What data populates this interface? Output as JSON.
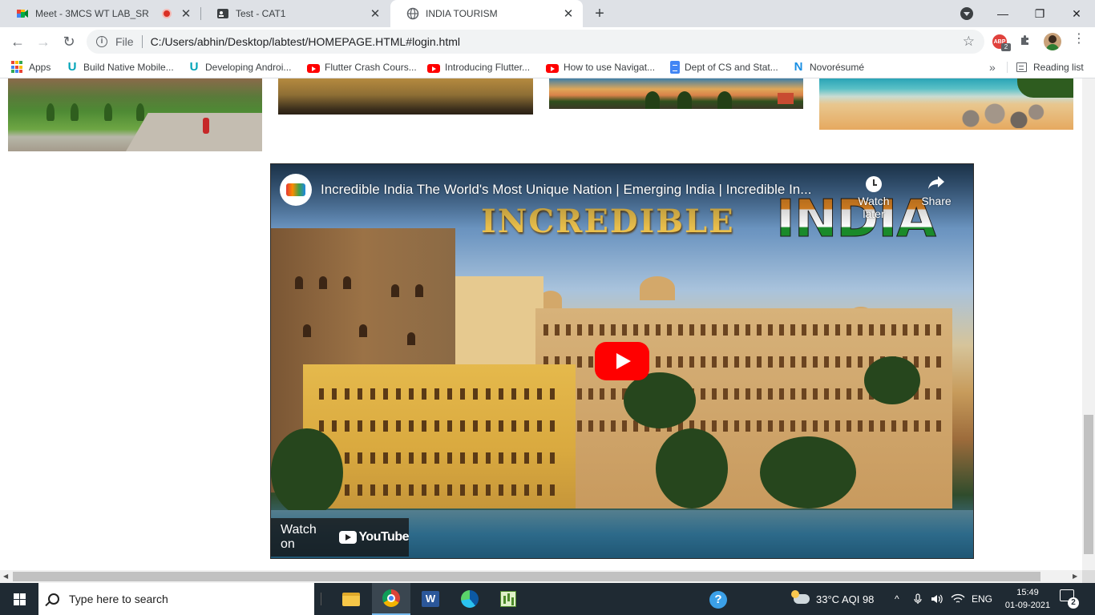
{
  "browser": {
    "tabs": [
      {
        "label": "Meet - 3MCS WT LAB_SR",
        "recording": true
      },
      {
        "label": "Test - CAT1"
      },
      {
        "label": "INDIA TOURISM",
        "active": true
      }
    ],
    "new_tab_symbol": "+",
    "window_controls": {
      "minimize": "—",
      "restore": "❐",
      "close": "✕"
    },
    "address": {
      "scheme_label": "File",
      "url": "C:/Users/abhin/Desktop/labtest/HOMEPAGE.HTML#login.html"
    },
    "extensions": {
      "abp_label": "ABP",
      "abp_badge": "2"
    },
    "nav": {
      "back": "←",
      "forward": "→",
      "reload": "↻",
      "star": "☆",
      "menu": "⋮"
    }
  },
  "bookmarks": {
    "items": [
      {
        "label": "Apps",
        "icon": "apps-grid-icon"
      },
      {
        "label": "Build Native Mobile...",
        "icon": "udemy-icon"
      },
      {
        "label": "Developing Androi...",
        "icon": "udemy-icon"
      },
      {
        "label": "Flutter Crash Cours...",
        "icon": "youtube-icon"
      },
      {
        "label": "Introducing Flutter...",
        "icon": "youtube-icon"
      },
      {
        "label": "How to use Navigat...",
        "icon": "youtube-icon"
      },
      {
        "label": "Dept of CS and Stat...",
        "icon": "google-docs-icon"
      },
      {
        "label": "Novorésumé",
        "icon": "novoresume-icon"
      }
    ],
    "overflow": "»",
    "reading_list": "Reading list"
  },
  "page": {
    "photos": [
      "garden-photo",
      "desert-photo",
      "beach-sunset-photo",
      "beach-rocks-photo"
    ],
    "video": {
      "title": "Incredible India The World's Most Unique Nation | Emerging India | Incredible In...",
      "thumbnail_text_1": "INCREDIBLE",
      "thumbnail_text_2": "INDIA",
      "watch_later": "Watch later",
      "share": "Share",
      "watch_on": "Watch on",
      "youtube_wordmark": "YouTube"
    }
  },
  "taskbar": {
    "search_placeholder": "Type here to search",
    "weather": "33°C  AQI 98",
    "language": "ENG",
    "time": "15:49",
    "date": "01-09-2021",
    "notifications": "2",
    "tray_chevron": "^",
    "word_letter": "W",
    "help_symbol": "?"
  }
}
